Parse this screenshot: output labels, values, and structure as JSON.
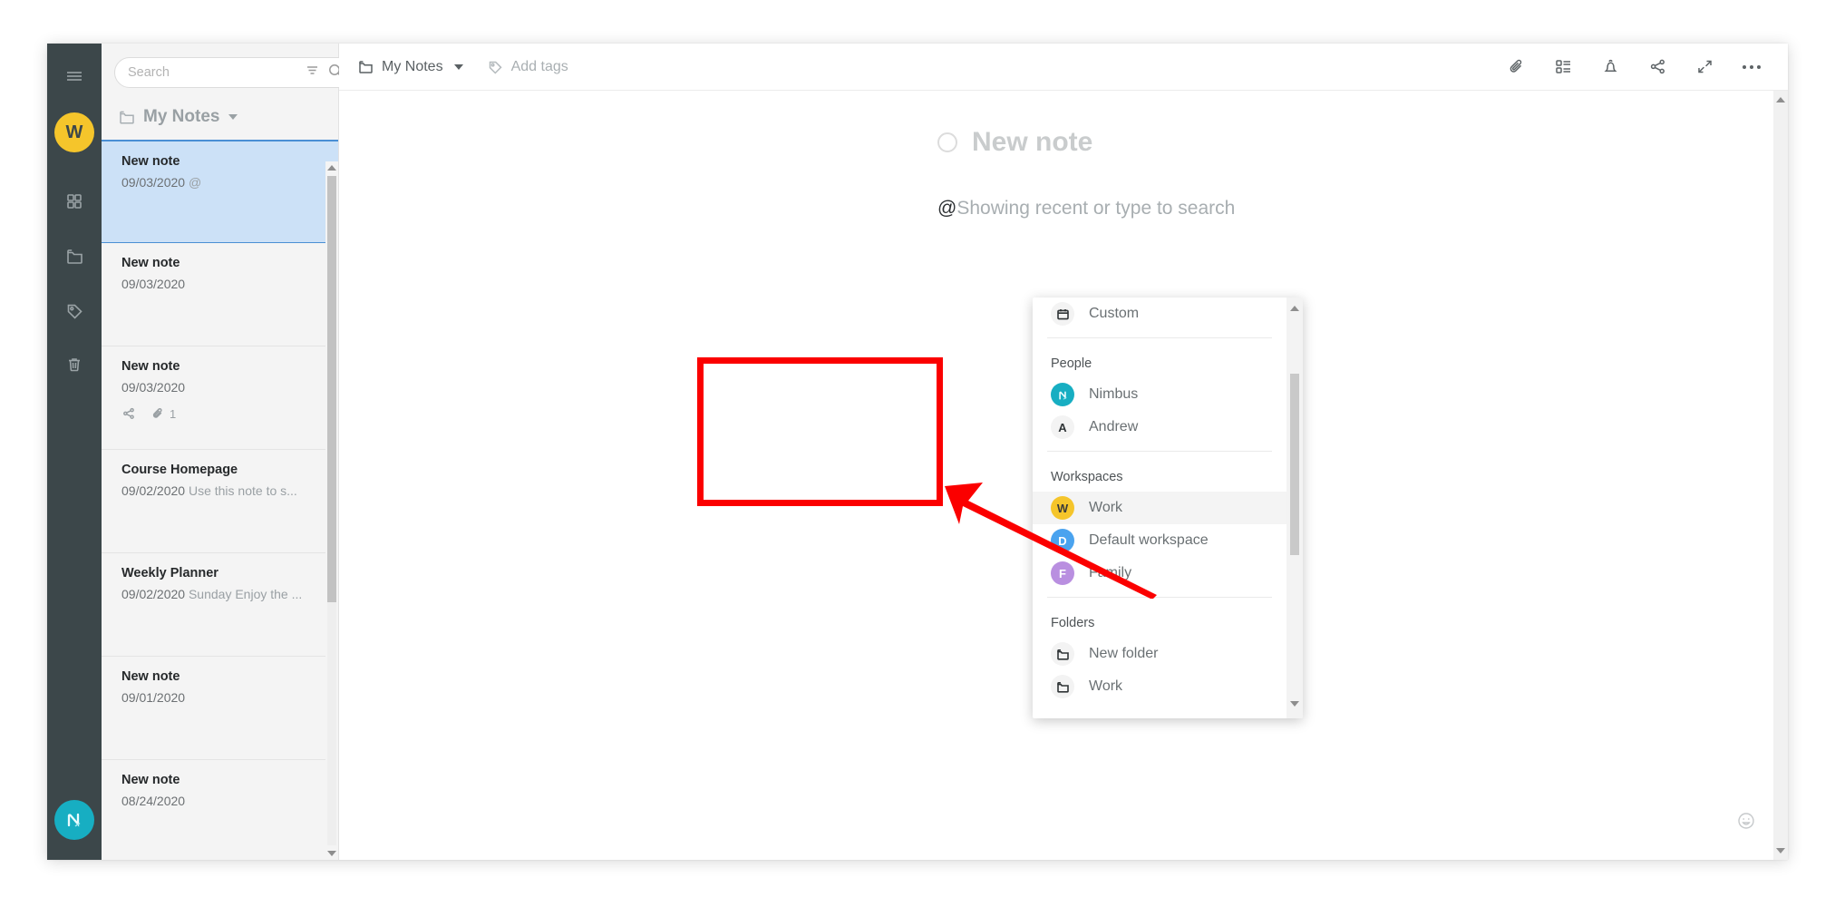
{
  "rail": {
    "menu_icon": "hamburger-menu-icon",
    "workspace_avatar": "W",
    "items": [
      {
        "icon": "grid-icon",
        "name": "grid"
      },
      {
        "icon": "folder-icon",
        "name": "folders"
      },
      {
        "icon": "tag-icon",
        "name": "tags"
      },
      {
        "icon": "trash-icon",
        "name": "trash"
      }
    ],
    "bottom_logo": "nimbus-logo"
  },
  "search": {
    "placeholder": "Search",
    "value": "",
    "filter_icon": "filter-icon",
    "search_icon": "search-icon",
    "add_label": "+"
  },
  "folder_header": {
    "icon": "folder-icon",
    "title": "My Notes",
    "caret": "chevron-down-icon"
  },
  "notes": [
    {
      "title": "New note",
      "date": "09/03/2020",
      "snippet": "@",
      "active": true,
      "meta": []
    },
    {
      "title": "New note",
      "date": "09/03/2020",
      "snippet": "",
      "active": false,
      "meta": []
    },
    {
      "title": "New note",
      "date": "09/03/2020",
      "snippet": "",
      "active": false,
      "meta": [
        {
          "icon": "share-icon",
          "text": ""
        },
        {
          "icon": "paperclip-icon",
          "text": "1"
        }
      ]
    },
    {
      "title": "Course Homepage",
      "date": "09/02/2020",
      "snippet": "Use this note to s...",
      "active": false,
      "meta": []
    },
    {
      "title": "Weekly Planner",
      "date": "09/02/2020",
      "snippet": "Sunday Enjoy the ...",
      "active": false,
      "meta": []
    },
    {
      "title": "New note",
      "date": "09/01/2020",
      "snippet": "",
      "active": false,
      "meta": []
    },
    {
      "title": "New note",
      "date": "08/24/2020",
      "snippet": "",
      "active": false,
      "meta": []
    }
  ],
  "topbar": {
    "breadcrumb_icon": "folder-icon",
    "breadcrumb": "My Notes",
    "breadcrumb_caret": "chevron-down-icon",
    "tags_icon": "tag-icon",
    "tags_label": "Add tags",
    "icons": [
      {
        "name": "paperclip-icon"
      },
      {
        "name": "outline-list-icon"
      },
      {
        "name": "bell-icon"
      },
      {
        "name": "share-icon"
      },
      {
        "name": "expand-icon"
      },
      {
        "name": "more-options-icon"
      }
    ]
  },
  "note": {
    "title": "New note",
    "mention_at": "@",
    "mention_hint": "Showing recent or type to search"
  },
  "dropdown": {
    "top_item": {
      "icon": "calendar-icon",
      "label": "Custom"
    },
    "groups": [
      {
        "name": "people",
        "title": "People",
        "items": [
          {
            "avatar": "nimbus",
            "initial": "N",
            "label": "Nimbus",
            "selected": false
          },
          {
            "avatar": "grey",
            "initial": "A",
            "label": "Andrew",
            "selected": false
          }
        ]
      },
      {
        "name": "workspaces",
        "title": "Workspaces",
        "items": [
          {
            "avatar": "work",
            "initial": "W",
            "label": "Work",
            "selected": true
          },
          {
            "avatar": "default",
            "initial": "D",
            "label": "Default workspace",
            "selected": false
          },
          {
            "avatar": "family",
            "initial": "F",
            "label": "Family",
            "selected": false
          }
        ]
      },
      {
        "name": "folders",
        "title": "Folders",
        "items": [
          {
            "avatar": "icon-folder",
            "initial": "",
            "label": "New folder",
            "selected": false
          },
          {
            "avatar": "icon-folder",
            "initial": "",
            "label": "Work",
            "selected": false
          }
        ]
      }
    ]
  },
  "annotations": {
    "highlight_color": "#fb0000",
    "highlight_target": "workspaces-group",
    "arrow_color": "#fb0000"
  },
  "colors": {
    "rail_bg": "#3c474a",
    "accent_teal": "#04a1ba",
    "selection_blue": "#cce1f7",
    "workspace_yellow": "#f5c52b"
  },
  "footer": {
    "smiley_icon": "smiley-icon"
  }
}
